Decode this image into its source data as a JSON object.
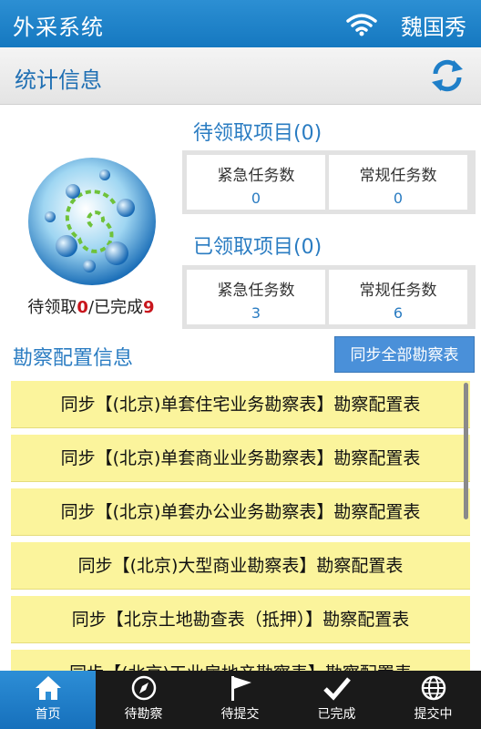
{
  "header": {
    "app_title": "外采系统",
    "user_name": "魏国秀"
  },
  "section": {
    "title": "统计信息"
  },
  "stats": {
    "pending": {
      "title": "待领取项目(0)",
      "urgent_label": "紧急任务数",
      "urgent_value": "0",
      "regular_label": "常规任务数",
      "regular_value": "0"
    },
    "received": {
      "title": "已领取项目(0)",
      "urgent_label": "紧急任务数",
      "urgent_value": "3",
      "regular_label": "常规任务数",
      "regular_value": "6"
    },
    "summary": {
      "pending_label": "待领取",
      "pending_count": "0",
      "separator": "/",
      "done_label": "已完成",
      "done_count": "9"
    }
  },
  "survey": {
    "title": "勘察配置信息",
    "sync_all_label": "同步全部勘察表",
    "items": [
      "同步【(北京)单套住宅业务勘察表】勘察配置表",
      "同步【(北京)单套商业业务勘察表】勘察配置表",
      "同步【(北京)单套办公业务勘察表】勘察配置表",
      "同步【(北京)大型商业勘察表】勘察配置表",
      "同步【北京土地勘查表（抵押）】勘察配置表",
      "同步【(北京)工业房地产勘察表】勘察配置表"
    ]
  },
  "tabs": [
    {
      "label": "首页",
      "icon": "home-icon"
    },
    {
      "label": "待勘察",
      "icon": "compass-icon"
    },
    {
      "label": "待提交",
      "icon": "flag-icon"
    },
    {
      "label": "已完成",
      "icon": "check-icon"
    },
    {
      "label": "提交中",
      "icon": "globe-icon"
    }
  ],
  "colors": {
    "primary": "#1f7fc8",
    "accent_text": "#2a7cc2",
    "count_red": "#c8161d",
    "list_bg": "#fbf49c",
    "tab_bg": "#1a1a1a"
  }
}
